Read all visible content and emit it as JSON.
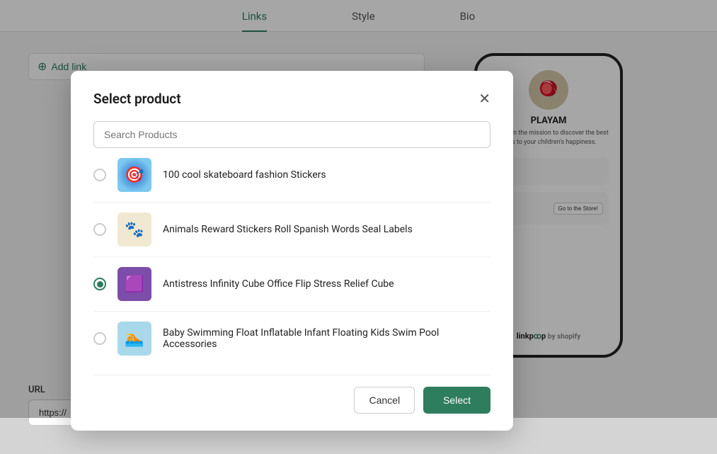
{
  "tabs": [
    {
      "label": "Links",
      "active": true
    },
    {
      "label": "Style",
      "active": false
    },
    {
      "label": "Bio",
      "active": false
    }
  ],
  "addLink": {
    "label": "Add link"
  },
  "url": {
    "label": "URL",
    "value": "https://                .myshopify.com/"
  },
  "phone": {
    "name": "PLAYAM",
    "bio": "We are on the mission to discover the best ways to your children's happiness.",
    "storeButton": "Go to the Store!",
    "footer": "linkpop by shopify"
  },
  "modal": {
    "title": "Select product",
    "searchPlaceholder": "Search Products",
    "products": [
      {
        "id": 1,
        "name": "100 cool skateboard fashion Stickers",
        "selected": false,
        "thumbClass": "thumb-skateboard",
        "emoji": "🎯"
      },
      {
        "id": 2,
        "name": "Animals Reward Stickers Roll Spanish Words Seal Labels",
        "selected": false,
        "thumbClass": "thumb-stickers",
        "emoji": "🐾"
      },
      {
        "id": 3,
        "name": "Antistress Infinity Cube Office Flip Stress Relief Cube",
        "selected": true,
        "thumbClass": "thumb-cube",
        "emoji": "🟪"
      },
      {
        "id": 4,
        "name": "Baby Swimming Float Inflatable Infant Floating Kids Swim Pool Accessories",
        "selected": false,
        "thumbClass": "thumb-swim",
        "emoji": "🏊"
      }
    ],
    "cancelLabel": "Cancel",
    "selectLabel": "Select"
  }
}
